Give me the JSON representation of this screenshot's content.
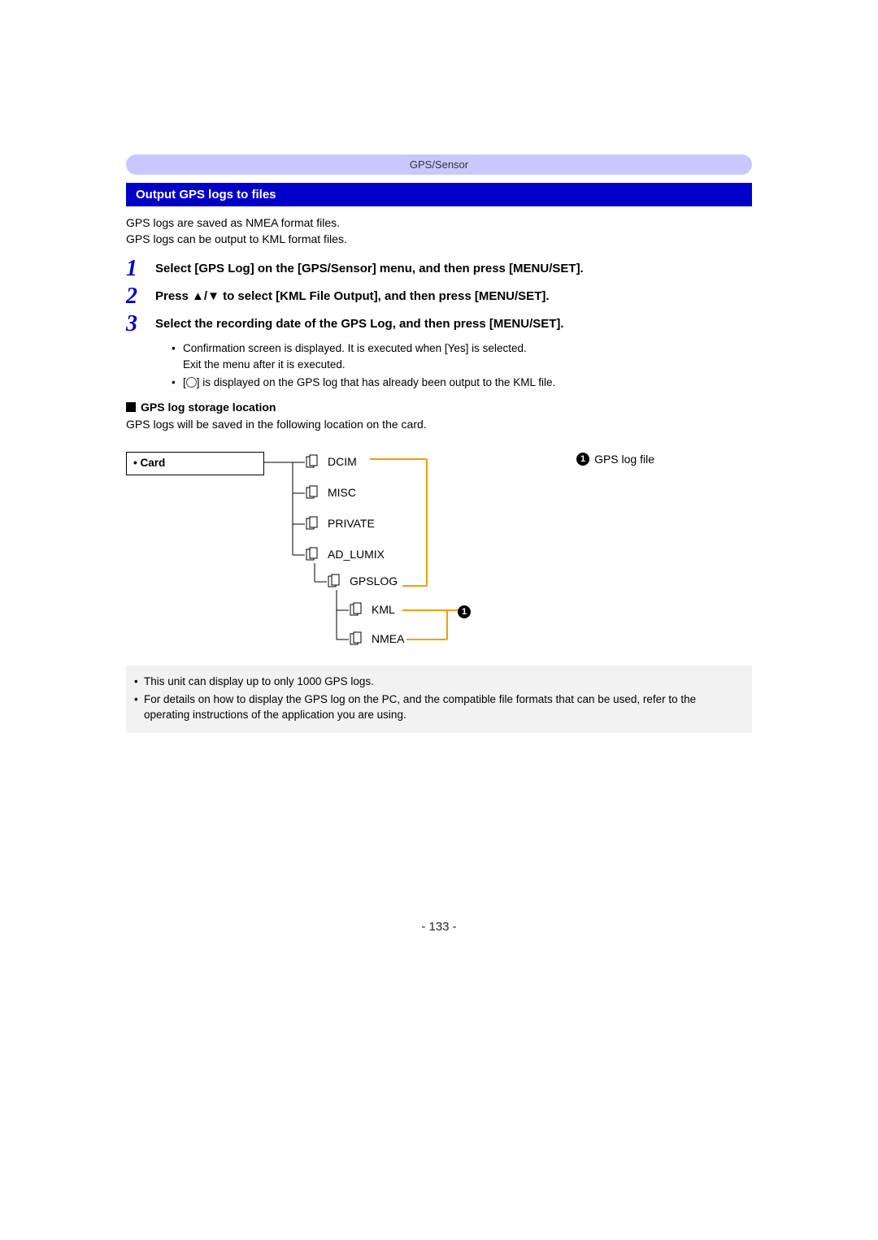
{
  "breadcrumb": "GPS/Sensor",
  "section_title": "Output GPS logs to files",
  "intro_line1": "GPS logs are saved as NMEA format files.",
  "intro_line2": "GPS logs can be output to KML format files.",
  "steps": {
    "s1": {
      "num": "1",
      "text": "Select [GPS Log] on the [GPS/Sensor] menu, and then press [MENU/SET]."
    },
    "s2": {
      "num": "2",
      "text_prefix": "Press ",
      "text_suffix": " to select [KML File Output], and then press [MENU/SET]."
    },
    "s3": {
      "num": "3",
      "text": "Select the recording date of the GPS Log, and then press [MENU/SET]."
    }
  },
  "sub_bullets": {
    "b1a": "Confirmation screen is displayed. It is executed when [Yes] is selected.",
    "b1b": "Exit the menu after it is executed.",
    "b2": "] is displayed on the GPS log that has already been output to the KML file.",
    "b2_prefix": "["
  },
  "storage": {
    "title": "GPS log storage location",
    "desc": "GPS logs will be saved in the following location on the card."
  },
  "diagram": {
    "card": "Card",
    "dcim": "DCIM",
    "misc": "MISC",
    "private": "PRIVATE",
    "ad_lumix": "AD_LUMIX",
    "gpslog": "GPSLOG",
    "kml": "KML",
    "nmea": "NMEA",
    "legend_num": "1",
    "legend_label": "GPS log file"
  },
  "notes": {
    "n1": "This unit can display up to only 1000 GPS logs.",
    "n2": "For details on how to display the GPS log on the PC, and the compatible file formats that can be used, refer to the operating instructions of the application you are using."
  },
  "page_number": "- 133 -"
}
